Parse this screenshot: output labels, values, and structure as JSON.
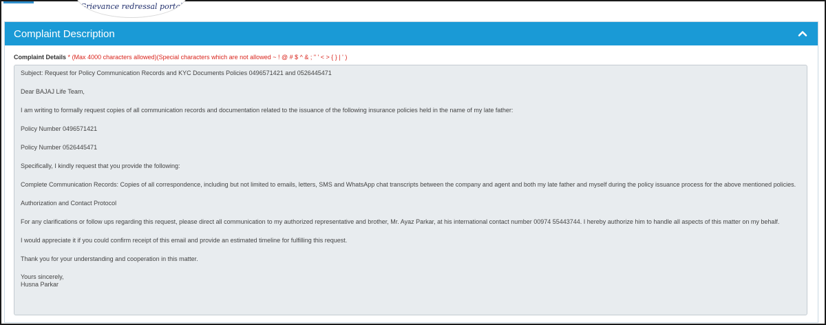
{
  "header": {
    "logo_tagline": "Grievance redressal portal"
  },
  "panel": {
    "title": "Complaint Description"
  },
  "field": {
    "label": "Complaint Details",
    "required_marker": "*",
    "hint": "(Max 4000 characters allowed)(Special characters which are not allowed ~ ! @ # $ ^ & ; \" ' < > { } | ' )"
  },
  "complaint": {
    "lines": [
      "Subject: Request for Policy Communication Records and KYC Documents Policies 0496571421 and 0526445471",
      "Dear BAJAJ Life Team,",
      "I am writing to formally request copies of all communication records and documentation related to the issuance of the following insurance policies held in the name of my late father:",
      "Policy Number 0496571421",
      "Policy Number 0526445471",
      "Specifically, I kindly request that you provide the following:",
      "Complete Communication Records: Copies of all correspondence, including but not limited to emails, letters, SMS and WhatsApp chat transcripts between the company and agent and both my late father and myself during the policy issuance process for the above mentioned policies.",
      "Authorization and Contact Protocol",
      "For any clarifications or follow ups regarding this request, please direct all communication to my authorized representative and brother, Mr. Ayaz Parkar, at his international contact number 00974 55443744. I hereby authorize him to handle all aspects of this matter on my behalf.",
      "I would appreciate it if you could confirm receipt of this email and provide an estimated timeline for fulfilling this request.",
      "Thank you for your understanding and cooperation in this matter.",
      "Yours sincerely,",
      "Husna Parkar"
    ]
  },
  "icons": {
    "collapse": "chevron-up-icon"
  },
  "colors": {
    "heading_bg": "#1a9ad6",
    "required_red": "#d9241c",
    "textarea_bg": "#e8ecef"
  }
}
